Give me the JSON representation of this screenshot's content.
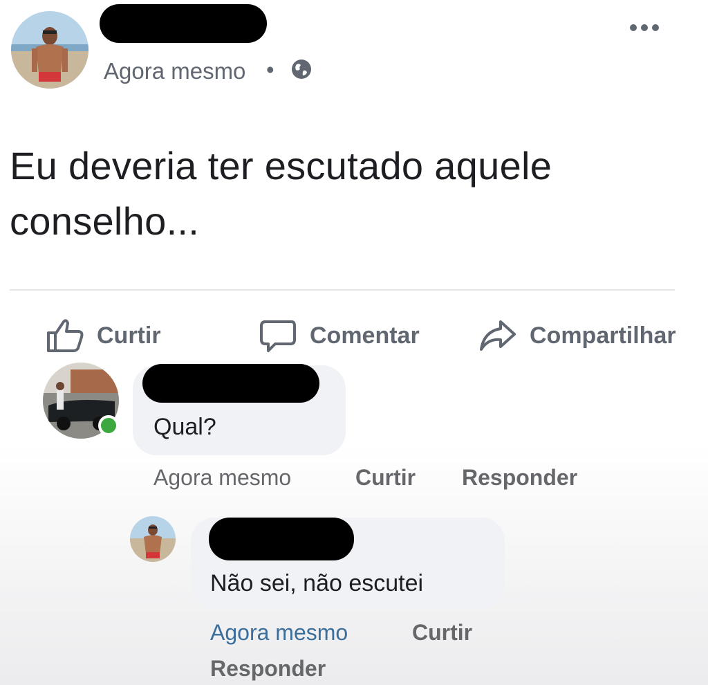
{
  "post": {
    "time": "Agora mesmo",
    "dot": "•",
    "text": "Eu deveria ter escutado aquele conselho..."
  },
  "actions": {
    "like": "Curtir",
    "comment": "Comentar",
    "share": "Compartilhar"
  },
  "comments": [
    {
      "text": "Qual?",
      "time": "Agora mesmo",
      "like": "Curtir",
      "reply": "Responder"
    },
    {
      "text": "Não sei, não escutei",
      "time": "Agora mesmo",
      "like": "Curtir",
      "reply": "Responder"
    }
  ],
  "icons": {
    "globe": "globe-icon",
    "more": "more-options-icon",
    "like": "thumbs-up-icon",
    "comment": "speech-bubble-icon",
    "share": "share-arrow-icon"
  },
  "colors": {
    "meta_gray": "#606770",
    "online": "#3ca83f",
    "link_blue": "#3b6e9b"
  }
}
